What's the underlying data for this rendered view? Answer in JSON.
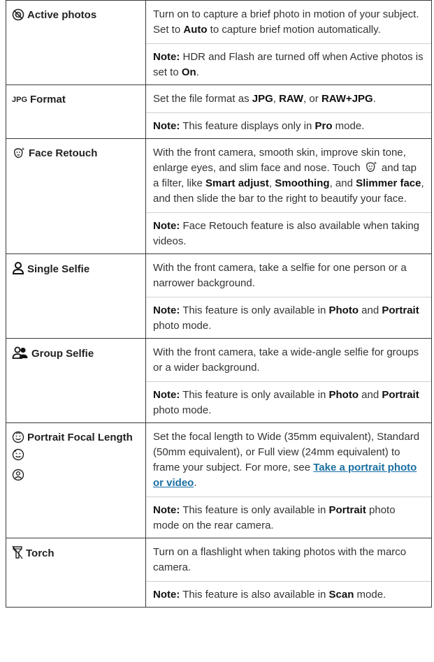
{
  "rows": [
    {
      "label": "Active photos",
      "icon": "active-photos-off-icon",
      "desc": [
        "Turn on to capture a brief photo in motion of your subject. Set to ",
        "Auto",
        " to capture brief motion automatically."
      ],
      "note": [
        "Note:",
        " HDR and Flash are turned off when Active photos is set to ",
        "On",
        "."
      ]
    },
    {
      "label": "Format",
      "icon_text": "JPG",
      "desc": [
        "Set the file format as ",
        "JPG",
        ", ",
        "RAW",
        ", or ",
        "RAW+JPG",
        "."
      ],
      "note": [
        "Note:",
        " This feature displays only in ",
        "Pro",
        " mode."
      ]
    },
    {
      "label": "Face Retouch",
      "icon": "face-retouch-icon",
      "desc": [
        "With the front camera, smooth skin, improve skin tone, enlarge eyes, and slim face and nose. Touch ",
        " and tap a filter, like ",
        "Smart adjust",
        ", ",
        "Smoothing",
        ", and ",
        "Slimmer face",
        ", and then slide the bar to the right to beautify your face."
      ],
      "note": [
        "Note:",
        " Face Retouch feature is also available when taking videos."
      ]
    },
    {
      "label": "Single Selfie",
      "icon": "single-person-icon",
      "desc": [
        "With the front camera, take a selfie for one person or a narrower background."
      ],
      "note": [
        "Note:",
        " This feature is only available in ",
        "Photo",
        " and ",
        "Portrait",
        " photo mode."
      ]
    },
    {
      "label": "Group Selfie",
      "icon": "group-people-icon",
      "desc": [
        "With the front camera, take a wide-angle selfie for groups or a wider background."
      ],
      "note": [
        "Note:",
        " This feature is only available in ",
        "Photo",
        " and ",
        "Portrait",
        " photo mode."
      ]
    },
    {
      "label": "Portrait Focal Length",
      "icon": "portrait-face-icon",
      "desc": [
        "Set the focal length to Wide (35mm equivalent), Standard (50mm equivalent), or Full view (24mm equivalent) to frame your subject. For more, see ",
        "Take a portrait photo or video",
        "."
      ],
      "note": [
        "Note:",
        " This feature is only available in ",
        "Portrait",
        " photo mode on the rear camera."
      ]
    },
    {
      "label": "Torch",
      "icon": "torch-icon",
      "desc": [
        "Turn on a flashlight when taking photos with the marco camera."
      ],
      "note": [
        "Note:",
        " This feature is also available in ",
        "Scan",
        " mode."
      ]
    }
  ],
  "colors": {
    "link": "#1a6fa0",
    "border": "#3a3a3a",
    "text": "#333333"
  }
}
